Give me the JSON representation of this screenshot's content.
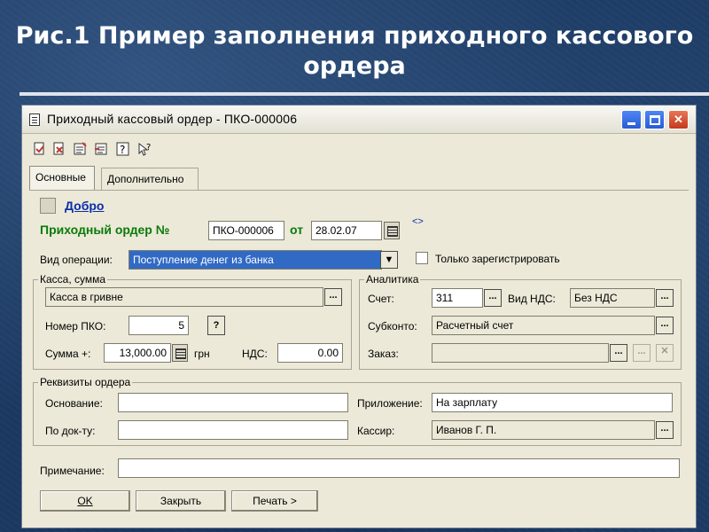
{
  "slide": {
    "title_line1": "Рис.1 Пример заполнения приходного кассового",
    "title_line2": "ордера"
  },
  "window": {
    "title": "Приходный кассовый ордер - ПКО-000006",
    "controls": {
      "minimize": "_",
      "maximize": "□",
      "close": "✕"
    }
  },
  "toolbar": {
    "icons": [
      "new-document-icon",
      "delete-document-icon",
      "post-icon",
      "unpost-icon",
      "help-icon",
      "whats-this-icon"
    ]
  },
  "tabs": [
    {
      "label": "Основные",
      "active": true
    },
    {
      "label": "Дополнительно",
      "active": false
    }
  ],
  "header": {
    "approve_link": "Добро",
    "order_label": "Приходный ордер №",
    "order_number": "ПКО-000006",
    "from_label": "от",
    "date": "28.02.07",
    "swap_glyph": "<>"
  },
  "operation": {
    "label": "Вид операции:",
    "value": "Поступление денег из банка",
    "register_only_label": "Только зарегистрировать",
    "register_only_checked": false
  },
  "kassa_group": {
    "title": "Касса, сумма",
    "kassa_value": "Касса в гривне",
    "pko_number_label": "Номер ПКО:",
    "pko_number": "5",
    "pko_help": "?",
    "sum_label": "Сумма +:",
    "sum_value": "13,000.00",
    "currency": "грн",
    "vat_label": "НДС:",
    "vat_value": "0.00"
  },
  "analytics_group": {
    "title": "Аналитика",
    "account_label": "Счет:",
    "account_value": "311",
    "vat_type_label": "Вид НДС:",
    "vat_type_value": "Без НДС",
    "subconto_label": "Субконто:",
    "subconto_value": "Расчетный счет",
    "order_label": "Заказ:",
    "order_value": ""
  },
  "requisites_group": {
    "title": "Реквизиты ордера",
    "basis_label": "Основание:",
    "basis_value": "",
    "by_doc_label": "По док-ту:",
    "by_doc_value": "",
    "attachment_label": "Приложение:",
    "attachment_value": "На зарплату",
    "cashier_label": "Кассир:",
    "cashier_value": "Иванов Г. П."
  },
  "note": {
    "label": "Примечание:",
    "value": ""
  },
  "buttons": {
    "ok": "OK",
    "close": "Закрыть",
    "print": "Печать >"
  },
  "colors": {
    "background": "#1c3a63",
    "window": "#ece9d8",
    "link": "#0a2ea8",
    "order_title": "#0a7a0a",
    "selection": "#316ac5"
  }
}
